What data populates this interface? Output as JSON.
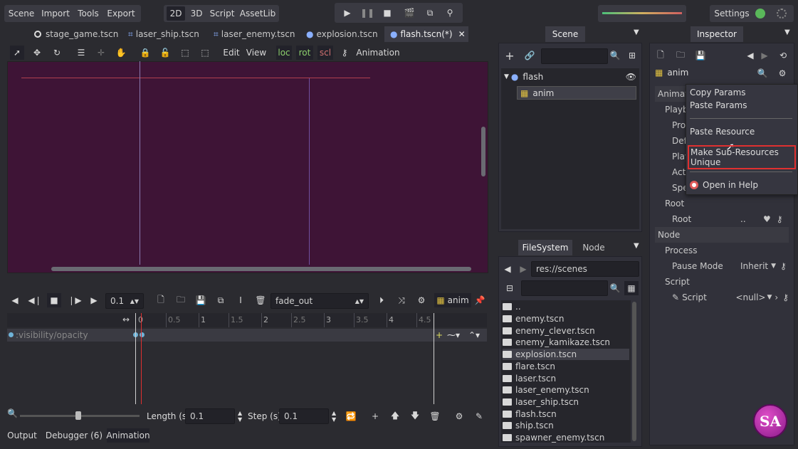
{
  "menu": {
    "scene": "Scene",
    "import": "Import",
    "tools": "Tools",
    "export": "Export"
  },
  "modes": {
    "m2d": "2D",
    "m3d": "3D",
    "script": "Script",
    "assetlib": "AssetLib"
  },
  "settings_label": "Settings",
  "tabs": [
    {
      "label": "stage_game.tscn"
    },
    {
      "label": "laser_ship.tscn"
    },
    {
      "label": "laser_enemy.tscn"
    },
    {
      "label": "explosion.tscn"
    },
    {
      "label": "flash.tscn(*)"
    }
  ],
  "toolbar2d": {
    "edit": "Edit",
    "view": "View",
    "loc": "loc",
    "rot": "rot",
    "scl": "scl",
    "animation": "Animation"
  },
  "anim_panel": {
    "step_value": "0.1",
    "animation_name": "fade_out",
    "node_label": "anim",
    "ruler": [
      "0",
      "0.5",
      "1",
      "1.5",
      "2",
      "2.5",
      "3",
      "3.5",
      "4",
      "4.5"
    ],
    "track": ":visibility/opacity",
    "length_label": "Length (s):",
    "length_value": "0.1",
    "step_label": "Step (s):",
    "step_value2": "0.1"
  },
  "bottom_tabs": {
    "output": "Output",
    "debugger": "Debugger (6)",
    "animation": "Animation"
  },
  "scene_dock": {
    "title": "Scene",
    "root": "flash",
    "child": "anim"
  },
  "fs_dock": {
    "filesystem": "FileSystem",
    "node": "Node",
    "path": "res://scenes",
    "files": [
      ".. ",
      "enemy.tscn",
      "enemy_clever.tscn",
      "enemy_kamikaze.tscn",
      "explosion.tscn",
      "flare.tscn",
      "laser.tscn",
      "laser_enemy.tscn",
      "laser_ship.tscn",
      "flash.tscn",
      "ship.tscn",
      "spawner_enemy.tscn"
    ],
    "selected_index": 4
  },
  "inspector": {
    "title": "Inspector",
    "object": "anim",
    "rows": {
      "animation": "Animation",
      "playback": "Playback",
      "pro": "Pro",
      "def": "Def",
      "play": "Play",
      "acti": "Acti",
      "spe": "Spe",
      "root_section": "Root",
      "root": "Root",
      "root_value": "..",
      "node_section": "Node",
      "process": "Process",
      "pause_mode": "Pause Mode",
      "pause_value": "Inherit",
      "script_section": "Script",
      "script": "Script",
      "script_value": "<null>"
    }
  },
  "context_menu": {
    "copy": "Copy Params",
    "paste": "Paste Params",
    "paste_res": "Paste Resource",
    "make_unique": "Make Sub-Resources Unique",
    "help": "Open in Help"
  },
  "colors": {
    "viewport": "#3e1436",
    "highlight": "#e03030",
    "accent": "#6fb3d8"
  }
}
